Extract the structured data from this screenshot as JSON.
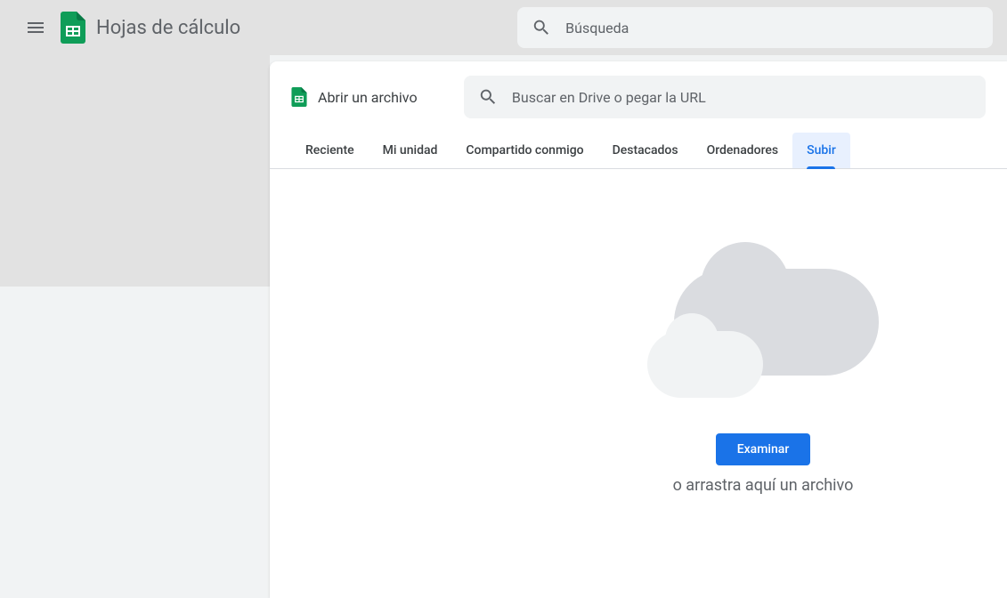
{
  "header": {
    "app_title": "Hojas de cálculo",
    "search_placeholder": "Búsqueda"
  },
  "dialog": {
    "title": "Abrir un archivo",
    "search_placeholder": "Buscar en Drive o pegar la URL",
    "tabs": {
      "recent": "Reciente",
      "my_drive": "Mi unidad",
      "shared": "Compartido conmigo",
      "starred": "Destacados",
      "computers": "Ordenadores",
      "upload": "Subir"
    },
    "upload": {
      "browse_button": "Examinar",
      "drag_text": "o arrastra aquí un archivo"
    }
  }
}
